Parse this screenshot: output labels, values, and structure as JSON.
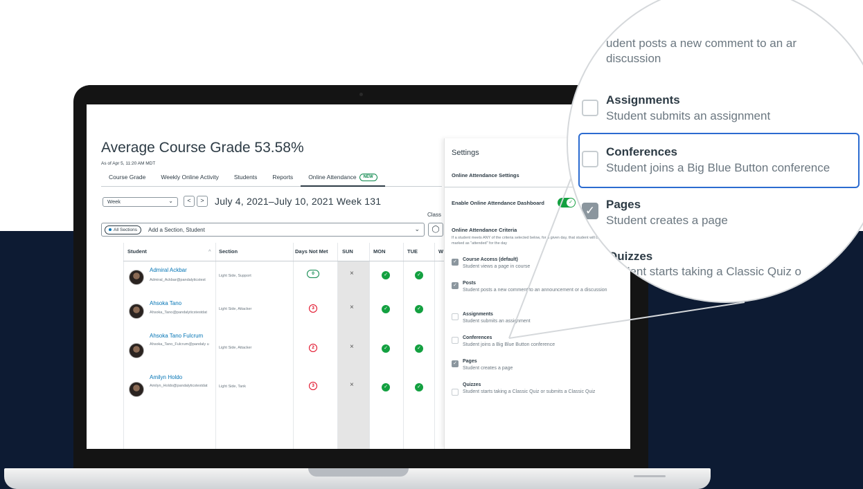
{
  "header": {
    "title": "Average Course Grade  53.58%",
    "as_of": "As of Apr 5, 11:20 AM MDT"
  },
  "tabs": [
    {
      "label": "Course Grade"
    },
    {
      "label": "Weekly Online Activity"
    },
    {
      "label": "Students"
    },
    {
      "label": "Reports"
    },
    {
      "label": "Online Attendance",
      "badge": "NEW",
      "active": true
    }
  ],
  "toolbar": {
    "week_select": "Week",
    "prev": "<",
    "next": ">",
    "date_range": "July 4, 2021–July 10, 2021 Week 131",
    "class_label": "Class",
    "filter_chip": "All Sections",
    "filter_placeholder": "Add a Section, Student"
  },
  "table": {
    "columns": [
      "Student",
      "Section",
      "Days Not Met",
      "SUN",
      "MON",
      "TUE",
      "W"
    ],
    "rows": [
      {
        "name": "Admiral Ackbar",
        "email": "Admiral_Ackbar@pandalyticstest",
        "section": "Light Side, Support",
        "days_not_met": "0",
        "status": "met",
        "sun": "×"
      },
      {
        "name": "Ahsoka Tano",
        "email": "Ahsoka_Tano@pandalyticstestdat",
        "section": "Light Side, Attacker",
        "days_not_met": "3",
        "status": "not_met",
        "sun": "×"
      },
      {
        "name": "Ahsoka Tano Fulcrum",
        "email": "Ahsoka_Tano_Fulcrum@pandaly u",
        "section": "Light Side, Attacker",
        "days_not_met": "2",
        "status": "not_met",
        "sun": "×"
      },
      {
        "name": "Amilyn Holdo",
        "email": "Amilyn_Holdo@pandalyticstestdat",
        "section": "Light Side, Tank",
        "days_not_met": "3",
        "status": "not_met",
        "sun": "×"
      }
    ]
  },
  "settings": {
    "title": "Settings",
    "subtitle": "Online Attendance Settings",
    "enable_label": "Enable Online Attendance Dashboard",
    "enabled": true,
    "criteria_title": "Online Attendance Criteria",
    "criteria_desc": "If a student meets ANY of the criteria selected below, for a given day, that student will be marked as \"attended\" for the day",
    "options": [
      {
        "name": "Course Access (default)",
        "desc": "Student views a page in course",
        "checked": true
      },
      {
        "name": "Posts",
        "desc": "Student posts a new comment to an announcement or a discussion",
        "checked": true
      },
      {
        "name": "Assignments",
        "desc": "Student submits an assignment",
        "checked": false
      },
      {
        "name": "Conferences",
        "desc": "Student joins a Big Blue Button conference",
        "checked": false
      },
      {
        "name": "Pages",
        "desc": "Student creates a page",
        "checked": true
      },
      {
        "name": "Quizzes",
        "desc": "Student starts taking a Classic Quiz or submits a Classic Quiz",
        "checked": false
      }
    ]
  },
  "zoom": {
    "posts_desc_fragment": "udent posts a new comment to an ar",
    "posts_desc_line2": "discussion",
    "assignments_name": "Assignments",
    "assignments_desc": "Student submits an assignment",
    "conferences_name": "Conferences",
    "conferences_desc": "Student joins a Big Blue Button conference",
    "pages_name": "Pages",
    "pages_desc": "Student creates a page",
    "quizzes_name": "Quizzes",
    "quizzes_desc_fragment": "dent starts taking a Classic Quiz o"
  },
  "colors": {
    "navy_background": "#0d1b33",
    "link_blue": "#0374b5",
    "success_green": "#13a040",
    "danger_red": "#e0061f",
    "highlight_blue": "#2b6bd0"
  }
}
